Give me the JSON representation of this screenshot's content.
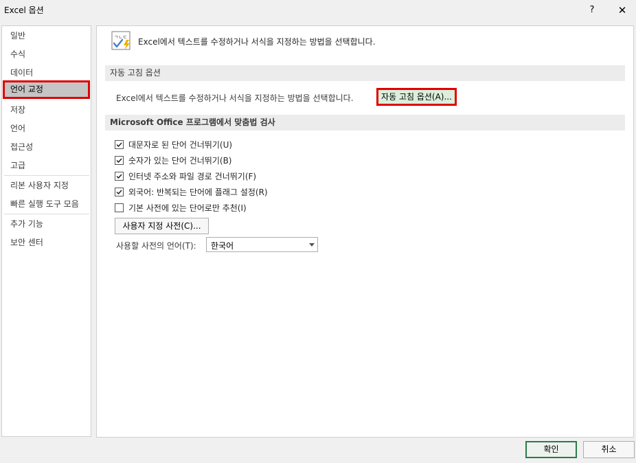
{
  "window": {
    "title": "Excel 옵션",
    "help_label": "?",
    "close_label": "✕"
  },
  "sidebar": {
    "items": [
      {
        "label": "일반"
      },
      {
        "label": "수식"
      },
      {
        "label": "데이터"
      },
      {
        "label": "언어 교정",
        "selected": true
      },
      {
        "label": "저장"
      },
      {
        "label": "언어"
      },
      {
        "label": "접근성"
      },
      {
        "label": "고급"
      },
      {
        "label": "리본 사용자 지정"
      },
      {
        "label": "빠른 실행 도구 모음"
      },
      {
        "label": "추가 기능"
      },
      {
        "label": "보안 센터"
      }
    ]
  },
  "main": {
    "header_icon": "proofing-abc-check-icon",
    "header_icon_text": "ㄱㄴㄷ",
    "header_text": "Excel에서 텍스트를 수정하거나 서식을 지정하는 방법을 선택합니다.",
    "autocorrect_section": {
      "title": "자동 고침 옵션",
      "description": "Excel에서 텍스트를 수정하거나 서식을 지정하는 방법을 선택합니다.",
      "button_label": "자동 고침 옵션(A)..."
    },
    "spelling_section": {
      "title": "Microsoft Office 프로그램에서 맞춤법 검사",
      "checkboxes": [
        {
          "label": "대문자로 된 단어 건너뛰기(U)",
          "checked": true
        },
        {
          "label": "숫자가 있는 단어 건너뛰기(B)",
          "checked": true
        },
        {
          "label": "인터넷 주소와 파일 경로 건너뛰기(F)",
          "checked": true
        },
        {
          "label": "외국어: 반복되는 단어에 플래그 설정(R)",
          "checked": true
        },
        {
          "label": "기본 사전에 있는 단어로만 추천(I)",
          "checked": false
        }
      ],
      "custom_dict_button": "사용자 지정 사전(C)...",
      "dict_language_label": "사용할 사전의 언어(T):",
      "dict_language_value": "한국어"
    }
  },
  "footer": {
    "ok_label": "확인",
    "cancel_label": "취소"
  },
  "colors": {
    "highlight_border": "#e00000",
    "selected_bg": "#c5c5c5",
    "ok_border": "#2a7a4a",
    "icon_check": "#4a7fc1",
    "icon_bolt": "#f0b000"
  }
}
